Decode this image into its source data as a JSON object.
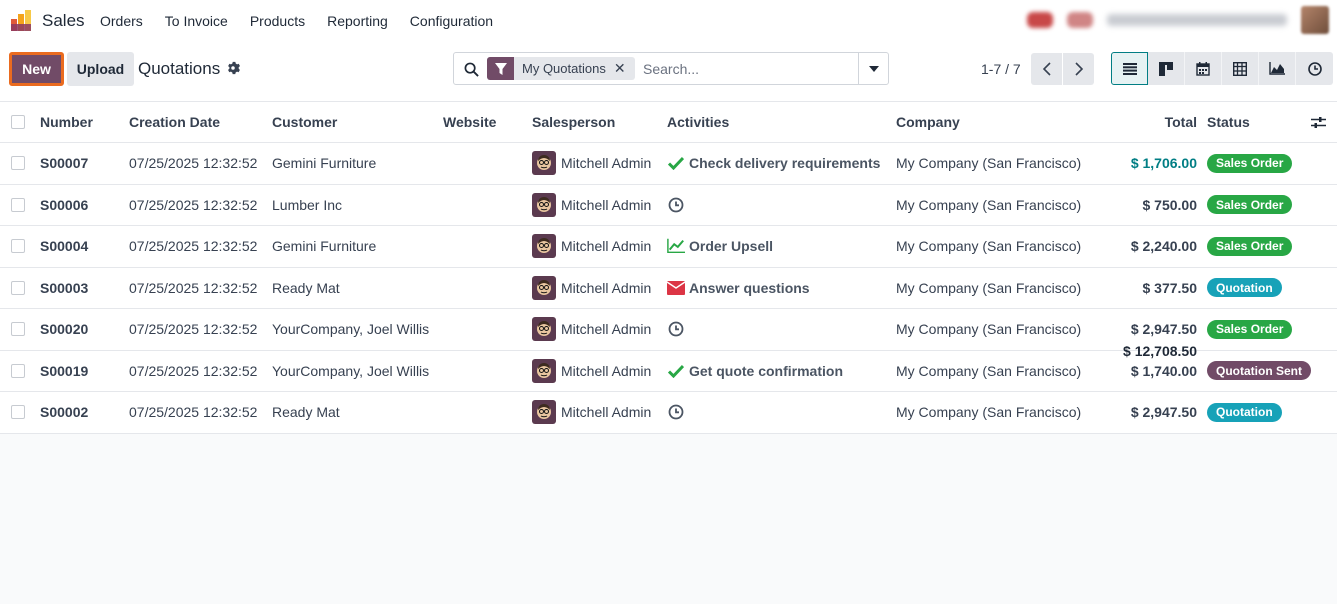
{
  "navbar": {
    "app_name": "Sales",
    "menu": [
      "Orders",
      "To Invoice",
      "Products",
      "Reporting",
      "Configuration"
    ]
  },
  "control": {
    "new_label": "New",
    "upload_label": "Upload",
    "title": "Quotations",
    "search": {
      "facet_label": "My Quotations",
      "placeholder": "Search..."
    },
    "pager": "1-7 / 7"
  },
  "colors": {
    "brand": "#714b67",
    "accent": "#017e84",
    "sales_order": "#28a745",
    "quotation": "#17a2b8",
    "quotation_sent": "#714b67"
  },
  "table": {
    "columns": [
      "Number",
      "Creation Date",
      "Customer",
      "Website",
      "Salesperson",
      "Activities",
      "Company",
      "Total",
      "Status"
    ],
    "rows": [
      {
        "number": "S00007",
        "date": "07/25/2025 12:32:52",
        "customer": "Gemini Furniture",
        "salesperson": "Mitchell Admin",
        "activity_icon": "check-icon",
        "activity": "Check delivery requirements",
        "company": "My Company (San Francisco)",
        "total": "$ 1,706.00",
        "status": "Sales Order"
      },
      {
        "number": "S00006",
        "date": "07/25/2025 12:32:52",
        "customer": "Lumber Inc",
        "salesperson": "Mitchell Admin",
        "activity_icon": "clock-icon",
        "activity": "",
        "company": "My Company (San Francisco)",
        "total": "$ 750.00",
        "status": "Sales Order"
      },
      {
        "number": "S00004",
        "date": "07/25/2025 12:32:52",
        "customer": "Gemini Furniture",
        "salesperson": "Mitchell Admin",
        "activity_icon": "chart-icon",
        "activity": "Order Upsell",
        "company": "My Company (San Francisco)",
        "total": "$ 2,240.00",
        "status": "Sales Order"
      },
      {
        "number": "S00003",
        "date": "07/25/2025 12:32:52",
        "customer": "Ready Mat",
        "salesperson": "Mitchell Admin",
        "activity_icon": "envelope-icon",
        "activity": "Answer questions",
        "company": "My Company (San Francisco)",
        "total": "$ 377.50",
        "status": "Quotation"
      },
      {
        "number": "S00020",
        "date": "07/25/2025 12:32:52",
        "customer": "YourCompany, Joel Willis",
        "salesperson": "Mitchell Admin",
        "activity_icon": "clock-icon",
        "activity": "",
        "company": "My Company (San Francisco)",
        "total": "$ 2,947.50",
        "status": "Sales Order"
      },
      {
        "number": "S00019",
        "date": "07/25/2025 12:32:52",
        "customer": "YourCompany, Joel Willis",
        "salesperson": "Mitchell Admin",
        "activity_icon": "check-icon",
        "activity": "Get quote confirmation",
        "company": "My Company (San Francisco)",
        "total": "$ 1,740.00",
        "status": "Quotation Sent"
      },
      {
        "number": "S00002",
        "date": "07/25/2025 12:32:52",
        "customer": "Ready Mat",
        "salesperson": "Mitchell Admin",
        "activity_icon": "clock-icon",
        "activity": "",
        "company": "My Company (San Francisco)",
        "total": "$ 2,947.50",
        "status": "Quotation"
      }
    ],
    "grand_total": "$ 12,708.50"
  }
}
